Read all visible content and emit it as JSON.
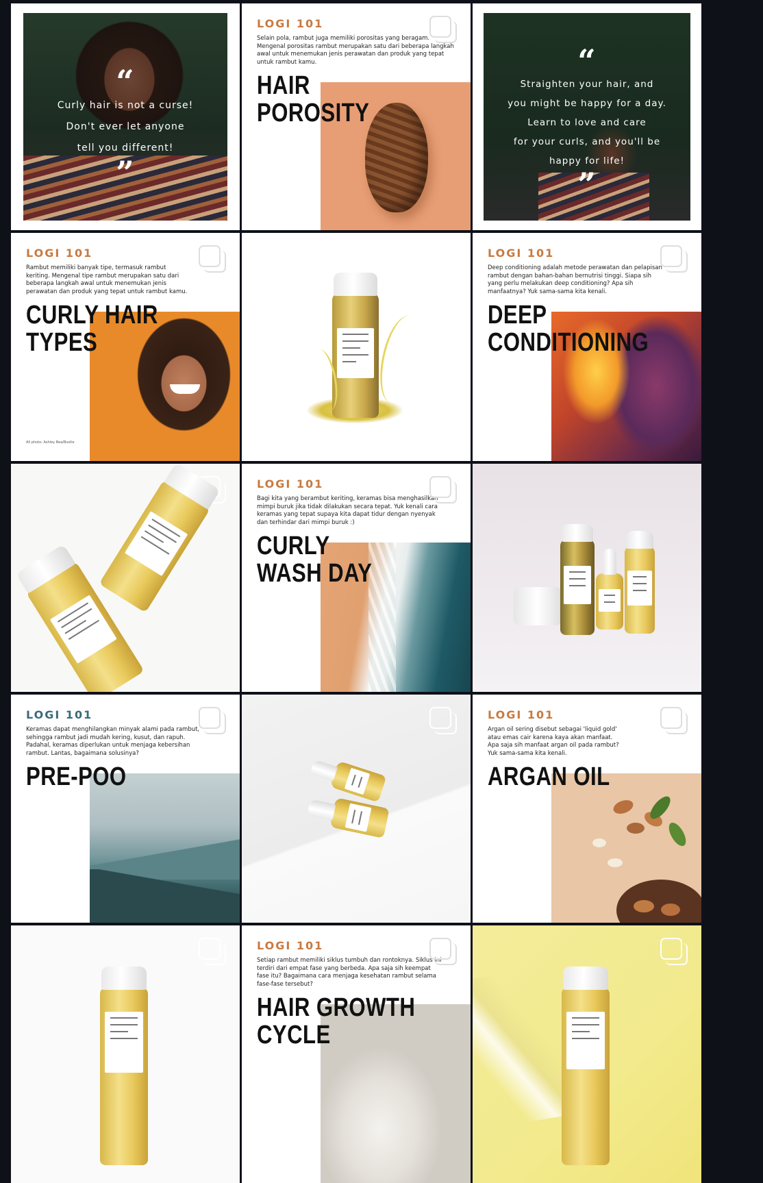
{
  "brand": {
    "name": "LOGI 101",
    "color": "#c87a40"
  },
  "tiles": {
    "quote1": {
      "open_mark": "“",
      "lines": [
        "Curly hair is not a curse!",
        "Don't ever let anyone",
        "tell you different!"
      ],
      "close_mark": "”"
    },
    "porosity": {
      "brand": "LOGI 101",
      "blurb": "Selain pola, rambut juga memiliki porositas yang beragam. Mengenal porositas rambut merupakan satu dari beberapa langkah awal untuk menemukan jenis perawatan dan produk yang tepat untuk rambut kamu.",
      "title_line1": "HAIR",
      "title_line2": "POROSITY",
      "accent": "#e89e74"
    },
    "quote2": {
      "open_mark": "“",
      "lines": [
        "Straighten your hair, and",
        "you might be happy for a day.",
        "Learn to love and care",
        "for your curls, and you'll be",
        "happy for life!"
      ],
      "close_mark": "”"
    },
    "curly_types": {
      "brand": "LOGI 101",
      "blurb": "Rambut memiliki banyak tipe, termasuk rambut keriting. Mengenal tipe rambut merupakan satu dari beberapa langkah awal untuk menemukan jenis perawatan dan produk yang tepat untuk rambut kamu.",
      "title_line1": "CURLY HAIR",
      "title_line2": "TYPES",
      "credit": "All photo: Ashley Bea/Bustle",
      "accent": "#e88a2a"
    },
    "deep_conditioning": {
      "brand": "LOGI 101",
      "blurb": "Deep conditioning adalah metode perawatan dan pelapisan rambut dengan bahan-bahan bernutrisi tinggi. Siapa sih yang perlu melakukan deep conditioning? Apa sih manfaatnya? Yuk sama-sama kita kenali.",
      "title_line1": "DEEP",
      "title_line2": "CONDITIONING"
    },
    "wash_day": {
      "brand": "LOGI 101",
      "blurb": "Bagi kita yang berambut keriting, keramas bisa menghasilkan mimpi buruk jika tidak dilakukan secara tepat. Yuk kenali cara keramas yang tepat supaya kita dapat tidur dengan nyenyak dan terhindar dari mimpi buruk :)",
      "title_line1": "CURLY",
      "title_line2": "WASH DAY"
    },
    "pre_poo": {
      "brand": "LOGI 101",
      "blurb": "Keramas dapat menghilangkan minyak alami pada rambut, sehingga rambut jadi mudah kering, kusut, dan rapuh. Padahal, keramas diperlukan untuk menjaga kebersihan rambut. Lantas, bagaimana solusinya?",
      "title_line1": "PRE-POO",
      "brand_color": "#3a6a78"
    },
    "argan": {
      "brand": "LOGI 101",
      "blurb": "Argan oil sering disebut sebagai 'liquid gold' atau emas cair karena kaya akan manfaat. Apa saja sih manfaat argan oil pada rambut? Yuk sama-sama kita kenali.",
      "title_line1": "ARGAN OIL"
    },
    "growth": {
      "brand": "LOGI 101",
      "blurb": "Setiap rambut memiliki siklus tumbuh dan rontoknya. Siklus ini terdiri dari empat fase yang berbeda. Apa saja sih keempat fase itu? Bagaimana cara menjaga kesehatan rambut selama fase-fase tersebut?",
      "title_line1": "HAIR GROWTH",
      "title_line2": "CYCLE"
    }
  }
}
